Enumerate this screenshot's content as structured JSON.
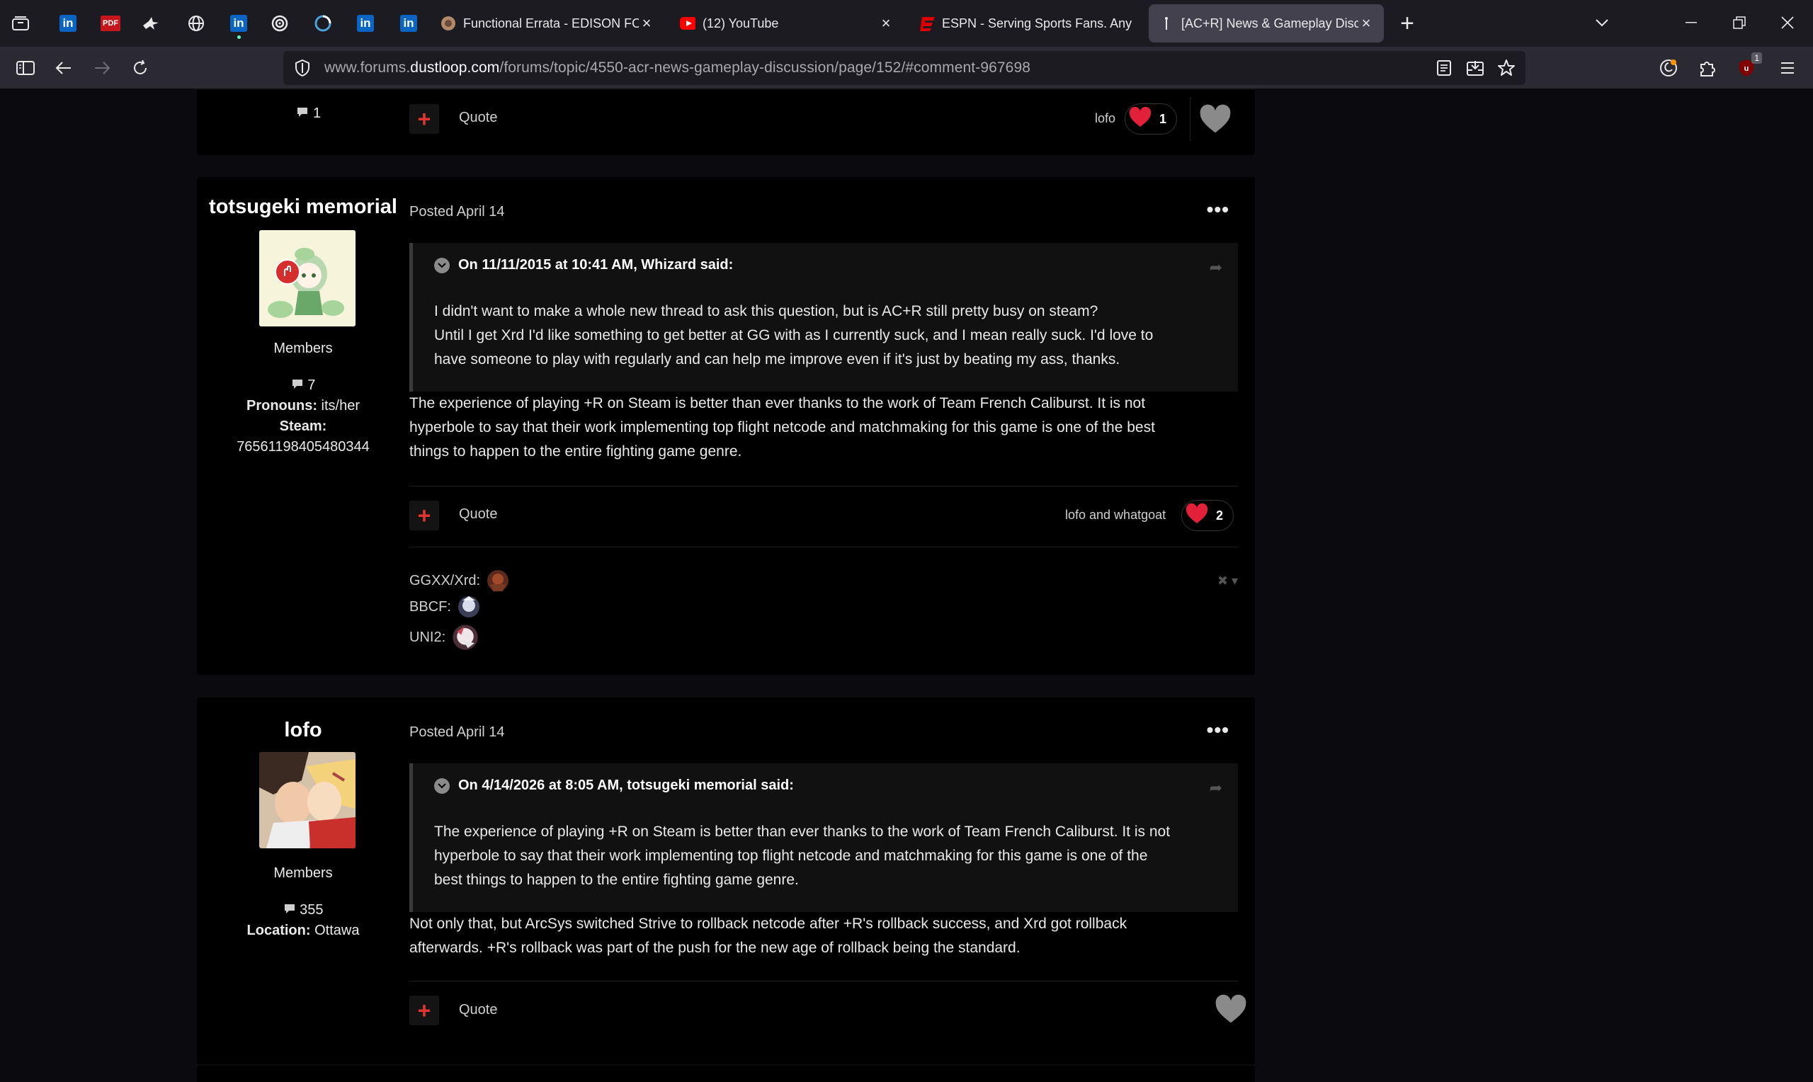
{
  "browser": {
    "tabs": [
      {
        "title": "Functional Errata - EDISON FOR",
        "favicon": "edison-favicon"
      },
      {
        "title": "(12) YouTube",
        "favicon": "youtube-favicon"
      },
      {
        "title": "ESPN - Serving Sports Fans. Any",
        "favicon": "espn-favicon"
      },
      {
        "title": "[AC+R] News & Gameplay Disc",
        "favicon": "dustloop-favicon",
        "active": true
      }
    ],
    "pinned_icons": [
      "linkedin-icon",
      "pdf-icon",
      "bird-icon",
      "globe-icon",
      "linkedin-icon",
      "swirl-icon",
      "ring-icon",
      "linkedin-icon",
      "linkedin-icon"
    ],
    "pdf_label": "PDF",
    "url_prefix": "www.forums.",
    "url_domain": "dustloop.com",
    "url_path": "/forums/topic/4550-acr-news-gameplay-discussion/page/152/#comment-967698",
    "extension_badge": "1"
  },
  "top_post_tail": {
    "comment_count": "1",
    "quote_label": "Quote",
    "likers": "lofo",
    "like_count": "1"
  },
  "post1": {
    "author": "totsugeki memorial",
    "role": "Members",
    "post_count": "7",
    "pronouns_label": "Pronouns:",
    "pronouns_value": "its/her",
    "steam_label": "Steam:",
    "steam_value": "76561198405480344",
    "posted": "Posted April 14",
    "quote_header": "On 11/11/2015 at 10:41 AM, Whizard said:",
    "quote_lines": [
      "I didn't want to make a whole new thread to ask this question, but is AC+R still pretty busy on steam?",
      "Until I get Xrd I'd like something to get better at GG with as I currently suck, and I mean really suck. I'd love to",
      "have someone to play with regularly and can help me improve even if it's just by beating my ass, thanks."
    ],
    "body_lines": [
      "The experience of playing +R on Steam is better than ever thanks to the work of Team French Caliburst. It is not",
      "hyperbole to say that their work implementing top flight netcode and matchmaking for this game is one of the best",
      "things to happen to the entire fighting game genre."
    ],
    "quote_label": "Quote",
    "likers": "lofo and whatgoat",
    "like_count": "2",
    "signature": [
      {
        "label": "GGXX/Xrd:"
      },
      {
        "label": "BBCF:"
      },
      {
        "label": "UNI2:"
      }
    ]
  },
  "post2": {
    "author": "lofo",
    "role": "Members",
    "post_count": "355",
    "location_label": "Location:",
    "location_value": "Ottawa",
    "posted": "Posted April 14",
    "quote_header": "On 4/14/2026 at 8:05 AM, totsugeki memorial said:",
    "quote_lines": [
      "The experience of playing +R on Steam is better than ever thanks to the work of Team French Caliburst. It is not",
      "hyperbole to say that their work implementing top flight netcode and matchmaking for this game is one of the",
      "best things to happen to the entire fighting game genre."
    ],
    "body_lines": [
      "Not only that, but ArcSys switched Strive to rollback netcode after +R's rollback success, and Xrd got rollback",
      "afterwards. +R's rollback was part of the push for the new age of rollback being the standard."
    ],
    "quote_label": "Quote"
  },
  "colors": {
    "heart": "#e3203a",
    "accent_red": "#e3352d",
    "page_bg": "#0b0b0f",
    "post_bg": "#000000"
  }
}
